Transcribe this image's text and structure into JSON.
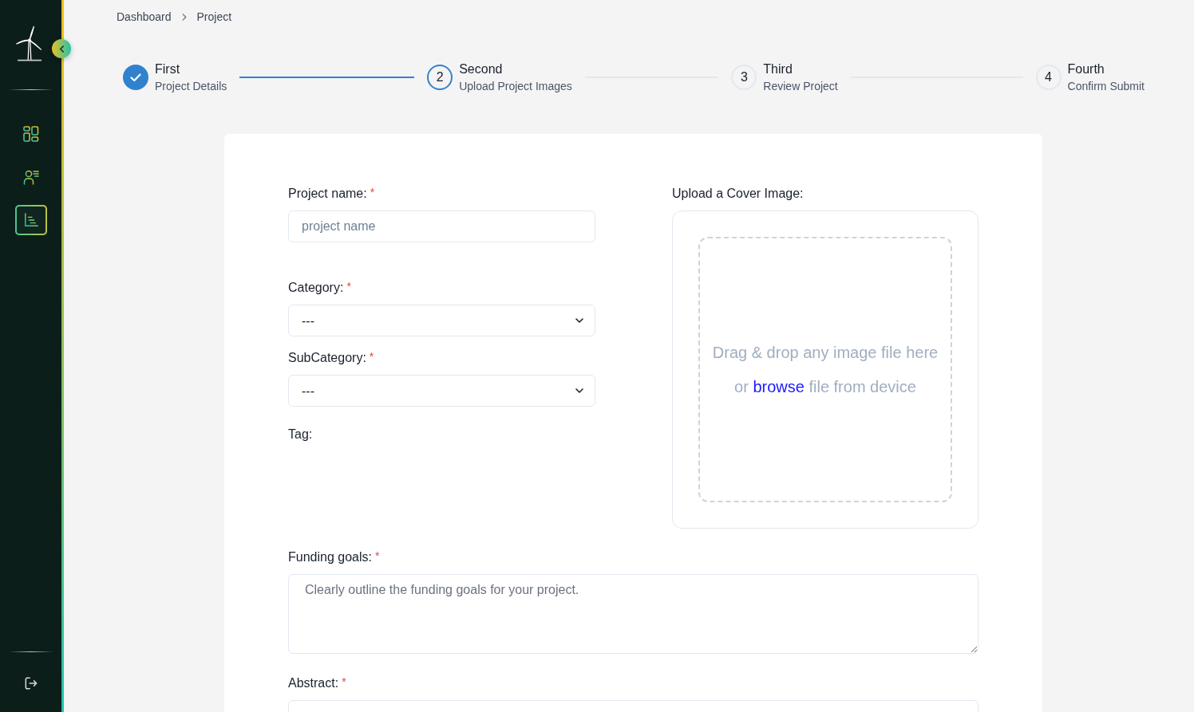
{
  "sidebar": {
    "nav_items": [
      {
        "selected": false
      },
      {
        "selected": false
      },
      {
        "selected": true
      }
    ]
  },
  "breadcrumb": [
    {
      "label": "Dashboard"
    },
    {
      "label": "Project"
    }
  ],
  "stepper": {
    "steps": [
      {
        "title": "First",
        "description": "Project Details",
        "completed": true,
        "active": false
      },
      {
        "number": "2",
        "title": "Second",
        "description": "Upload Project Images",
        "completed": false,
        "active": true
      },
      {
        "number": "3",
        "title": "Third",
        "description": "Review Project",
        "completed": false,
        "active": false
      },
      {
        "number": "4",
        "title": "Fourth",
        "description": "Confirm Submit",
        "completed": false,
        "active": false
      }
    ]
  },
  "form": {
    "fields_left": [
      {
        "kind": "text",
        "label": "Project name:",
        "required_mark": "*",
        "placeholder": "project name"
      },
      {
        "kind": "select",
        "label": "Category:",
        "required_mark": "*",
        "value": "---"
      },
      {
        "kind": "select",
        "label": "SubCategory:",
        "required_mark": "*",
        "value": "---"
      },
      {
        "kind": "tags",
        "label": "Tag:"
      }
    ],
    "upload": {
      "label": "Upload a Cover Image:",
      "prompt": "Drag & drop any image file here",
      "hint": {
        "prefix": "or",
        "link": "browse",
        "suffix": "file from device"
      }
    },
    "fields_full": [
      {
        "kind": "textarea",
        "label": "Funding goals:",
        "required_mark": "*",
        "placeholder": "Clearly outline the funding goals for your project."
      },
      {
        "kind": "textarea",
        "label": "Abstract:",
        "required_mark": "*"
      }
    ]
  }
}
